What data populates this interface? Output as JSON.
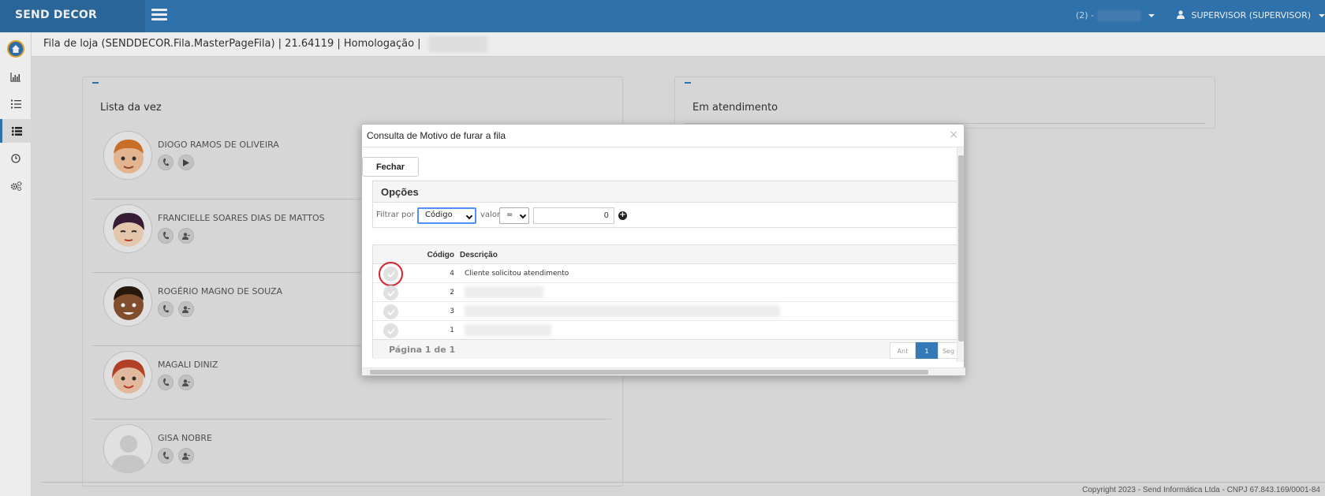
{
  "app": {
    "brand": "SEND DECOR",
    "store_label": "(2) -",
    "user_label": "SUPERVISOR (SUPERVISOR)"
  },
  "sidebar": {
    "items": [
      {
        "icon": "home-logo-icon",
        "active": false
      },
      {
        "icon": "bar-chart-icon",
        "active": false
      },
      {
        "icon": "list-ol-icon",
        "active": false
      },
      {
        "icon": "list-icon",
        "active": true
      },
      {
        "icon": "clock-icon",
        "active": false
      },
      {
        "icon": "cogs-icon",
        "active": false
      }
    ]
  },
  "breadcrumb": "Fila de loja (SENDDECOR.Fila.MasterPageFila) | 21.64119 | Homologação |",
  "left_panel": {
    "title": "Lista da vez",
    "items": [
      {
        "name": "DIOGO RAMOS DE OLIVEIRA",
        "second_action": "play"
      },
      {
        "name": "FRANCIELLE SOARES DIAS DE MATTOS",
        "second_action": "user"
      },
      {
        "name": "ROGÉRIO MAGNO DE SOUZA",
        "second_action": "user"
      },
      {
        "name": "MAGALI DINIZ",
        "second_action": "user"
      },
      {
        "name": "GISA NOBRE",
        "second_action": "user"
      }
    ]
  },
  "right_panel": {
    "title": "Em atendimento"
  },
  "modal": {
    "title": "Consulta de Motivo de furar a fila",
    "close_label": "×",
    "close_button": "Fechar",
    "options_title": "Opções",
    "filter_label": "Filtrar por",
    "filter_field": "Código",
    "value_label": "valor",
    "operator": "=",
    "filter_value": "0",
    "columns": [
      "Código",
      "Descrição"
    ],
    "rows": [
      {
        "codigo": "4",
        "descricao": "Cliente solicitou atendimento",
        "highlighted": true
      },
      {
        "codigo": "2",
        "descricao": "",
        "highlighted": false
      },
      {
        "codigo": "3",
        "descricao": "",
        "highlighted": false
      },
      {
        "codigo": "1",
        "descricao": "",
        "highlighted": false
      }
    ],
    "page_info": "Página 1 de 1",
    "pager": {
      "prev": "Ant",
      "current": "1",
      "next": "Seg"
    }
  },
  "footer": {
    "copyright": "Copyright 2023 - Send Informática Ltda - CNPJ 67.843.169/0001-84"
  },
  "colors": {
    "primary": "#337ab7",
    "highlight": "#d9232d"
  }
}
